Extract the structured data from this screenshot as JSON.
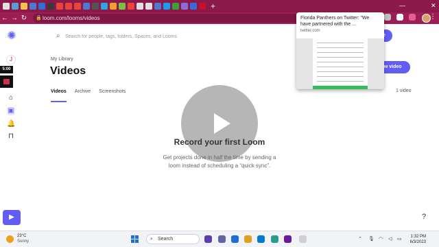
{
  "browser": {
    "tab_favicons": [
      "#e0e0e0",
      "#5b9bd5",
      "#f2c14e",
      "#4a7bd0",
      "#2f6fd8",
      "#3a3a3a",
      "#e8443a",
      "#e8443a",
      "#e8443a",
      "#4a7bd0",
      "#555555",
      "#2aa7e0",
      "#f0a030",
      "#7ac043",
      "#e8443a",
      "#e0e0e0",
      "#e0e0e0",
      "#4a7bd0",
      "#1d9bf0",
      "#3a9e3a",
      "#8c6cd8",
      "#3a6ad8",
      "#c8102e"
    ],
    "new_tab": "+",
    "url": "loom.com/looms/videos",
    "minimize": "—",
    "close": "✕",
    "back": "←",
    "forward": "→",
    "reload": "↻",
    "menu": "⋮",
    "profile_initial": ""
  },
  "preview": {
    "title": "Florida Panthers on Twitter: \"We have partnered with the ...",
    "domain": "twitter.com"
  },
  "sidebar": {
    "logo": "✺",
    "avatar_initial": "J",
    "timer": "5:00",
    "home_icon": "⌂",
    "library_icon": "▣",
    "bell_icon": "🔔",
    "bookmark_icon": "⊓",
    "record_icon": "▶"
  },
  "search": {
    "placeholder": "Search for people, tags, folders, Spaces, and Looms"
  },
  "main": {
    "breadcrumb": "My Library",
    "title": "Videos",
    "tabs": [
      {
        "label": "Videos",
        "active": true
      },
      {
        "label": "Archive",
        "active": false
      },
      {
        "label": "Screenshots",
        "active": false
      }
    ],
    "video_count": "1 video",
    "upgrade_partial": "ade",
    "new_video_partial": "ew video",
    "help": "?"
  },
  "empty_state": {
    "title": "Record your first Loom",
    "description": "Get projects done in half the time by sending a loom instead of scheduling a “quick sync”."
  },
  "taskbar": {
    "temperature": "23°C",
    "condition": "Sunny",
    "search_label": "Search",
    "time": "1:32 PM",
    "date": "6/3/2023",
    "apps": [
      "#5a3fb0",
      "#6264a7",
      "#1e6fd8",
      "#e0a020",
      "#0078d4",
      "#2a9d8f",
      "#6a1b9a",
      "#d0d0d0"
    ]
  },
  "colors": {
    "accent": "#625df5",
    "chrome": "#8b1a4a"
  }
}
